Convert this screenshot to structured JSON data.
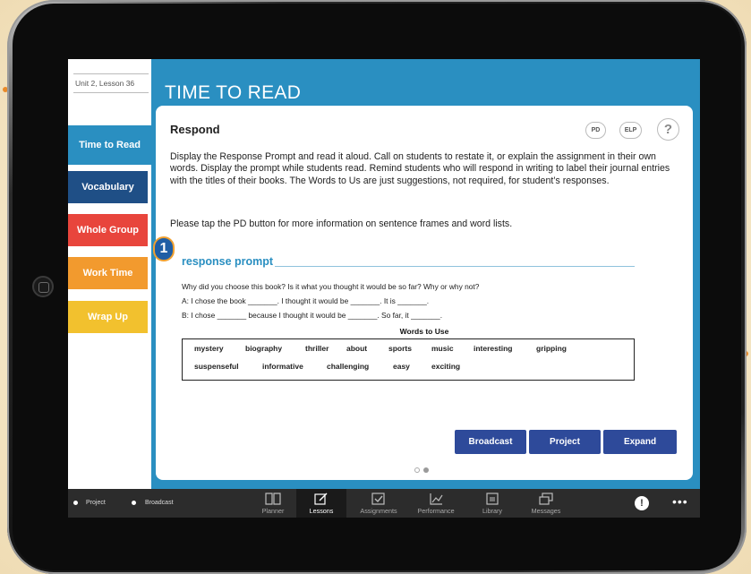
{
  "app": {
    "lesson_label": "Unit 2, Lesson 36",
    "page_title": "TIME TO READ"
  },
  "sidebar": {
    "items": [
      {
        "label": "Time to Read",
        "color": "#2a8fc1",
        "active": true
      },
      {
        "label": "Vocabulary",
        "color": "#1f4f86"
      },
      {
        "label": "Whole Group",
        "color": "#e8453c"
      },
      {
        "label": "Work Time",
        "color": "#f29a2e"
      },
      {
        "label": "Wrap Up",
        "color": "#f2c12e"
      }
    ]
  },
  "card": {
    "heading": "Respond",
    "pd_label": "PD",
    "elp_label": "ELP",
    "help_label": "?",
    "paragraph1": "Display the Response Prompt and read it aloud. Call on students to restate it, or explain the assignment in their own words. Display the prompt while students read. Remind students who will respond in writing to label their journal entries with the titles of their books. The Words to Us are just suggestions, not required, for student’s responses.",
    "paragraph2": "Please tap the PD button for more information on sentence frames and word lists.",
    "step_number": "1",
    "prompt_title": "response prompt",
    "prompt_question": "Why did you choose this book? Is it what you thought it would be so far? Why or why not?",
    "prompt_a": "A: I chose the book _______. I thought it would be _______. It is _______.",
    "prompt_b": "B: I chose _______ because I thought it would be _______. So far, it _______.",
    "words_title": "Words to Use",
    "words_row1": [
      "mystery",
      "biography",
      "thriller",
      "about",
      "sports",
      "music",
      "interesting",
      "gripping"
    ],
    "words_row2": [
      "suspenseful",
      "informative",
      "challenging",
      "easy",
      "exciting"
    ],
    "buttons": {
      "broadcast": "Broadcast",
      "project": "Project",
      "expand": "Expand"
    },
    "page_indicator": {
      "current": 2,
      "total": 2
    }
  },
  "tabbar": {
    "project_label": "Project",
    "broadcast_label": "Broadcast",
    "tabs": [
      {
        "label": "Planner",
        "icon": "book-icon"
      },
      {
        "label": "Lessons",
        "icon": "pencil-edit-icon",
        "active": true
      },
      {
        "label": "Assignments",
        "icon": "checkbox-icon"
      },
      {
        "label": "Performance",
        "icon": "chart-line-icon"
      },
      {
        "label": "Library",
        "icon": "library-icon"
      },
      {
        "label": "Messages",
        "icon": "messages-icon"
      }
    ],
    "user_icon": "user-icon",
    "more_icon": "more-icon"
  }
}
